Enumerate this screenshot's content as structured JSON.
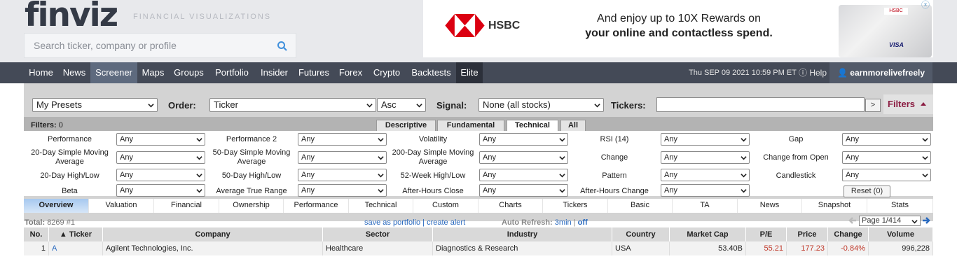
{
  "brand": {
    "logo": "finviz",
    "tagline": "FINANCIAL VISUALIZATIONS"
  },
  "search": {
    "placeholder": "Search ticker, company or profile",
    "icon": "search-icon"
  },
  "ad": {
    "brand": "HSBC",
    "line1": "And enjoy up to 10X Rewards on",
    "line2": "your online and contactless spend.",
    "card_brand": "HSBC",
    "card_network": "VISA",
    "close": "ⓧ"
  },
  "nav": {
    "items": [
      "Home",
      "News",
      "Screener",
      "Maps",
      "Groups",
      "Portfolio",
      "Insider",
      "Futures",
      "Forex",
      "Crypto",
      "Backtests",
      "Elite"
    ],
    "active": "Screener",
    "datetime": "Thu SEP 09 2021 10:59 PM ET",
    "help": "Help",
    "user": "earnmorelivefreely"
  },
  "controls": {
    "presets": "My Presets",
    "order_label": "Order:",
    "order_value": "Ticker",
    "direction": "Asc",
    "signal_label": "Signal:",
    "signal_value": "None (all stocks)",
    "tickers_label": "Tickers:",
    "tickers_value": "",
    "go": ">",
    "filters_toggle": "Filters"
  },
  "filters": {
    "title": "Filters:",
    "count": "0",
    "tabs": [
      "Descriptive",
      "Fundamental",
      "Technical",
      "All"
    ],
    "active_tab": "Technical",
    "rows": [
      [
        {
          "label": "Performance",
          "value": "Any"
        },
        {
          "label": "Performance 2",
          "value": "Any"
        },
        {
          "label": "Volatility",
          "value": "Any"
        },
        {
          "label": "RSI (14)",
          "value": "Any"
        },
        {
          "label": "Gap",
          "value": "Any"
        }
      ],
      [
        {
          "label": "20-Day Simple Moving Average",
          "value": "Any"
        },
        {
          "label": "50-Day Simple Moving Average",
          "value": "Any"
        },
        {
          "label": "200-Day Simple Moving Average",
          "value": "Any"
        },
        {
          "label": "Change",
          "value": "Any"
        },
        {
          "label": "Change from Open",
          "value": "Any"
        }
      ],
      [
        {
          "label": "20-Day High/Low",
          "value": "Any"
        },
        {
          "label": "50-Day High/Low",
          "value": "Any"
        },
        {
          "label": "52-Week High/Low",
          "value": "Any"
        },
        {
          "label": "Pattern",
          "value": "Any"
        },
        {
          "label": "Candlestick",
          "value": "Any"
        }
      ],
      [
        {
          "label": "Beta",
          "value": "Any"
        },
        {
          "label": "Average True Range",
          "value": "Any"
        },
        {
          "label": "After-Hours Close",
          "value": "Any"
        },
        {
          "label": "After-Hours Change",
          "value": "Any"
        }
      ]
    ],
    "reset": "Reset (0)"
  },
  "view_tabs": [
    "Overview",
    "Valuation",
    "Financial",
    "Ownership",
    "Performance",
    "Technical",
    "Custom",
    "Charts",
    "Tickers",
    "Basic",
    "TA",
    "News",
    "Snapshot",
    "Stats"
  ],
  "active_view": "Overview",
  "summary": {
    "total_label": "Total:",
    "total_value": "8269 #1",
    "save_portfolio": "save as portfolio",
    "separator": "|",
    "create_alert": "create alert",
    "auto_refresh_label": "Auto Refresh:",
    "auto_refresh_value": "3min",
    "auto_refresh_off": "off",
    "page": "Page 1/414"
  },
  "table": {
    "columns": [
      "No.",
      "▲ Ticker",
      "Company",
      "Sector",
      "Industry",
      "Country",
      "Market Cap",
      "P/E",
      "Price",
      "Change",
      "Volume"
    ],
    "rows": [
      [
        "1",
        "A",
        "Agilent Technologies, Inc.",
        "Healthcare",
        "Diagnostics & Research",
        "USA",
        "53.40B",
        "55.21",
        "177.23",
        "-0.84%",
        "996,228"
      ]
    ]
  },
  "colors": {
    "nav_bg": "#444a57",
    "active_tab": "#5e6a7e",
    "link": "#2a6abf",
    "negative": "#c0392b",
    "filters_toggle": "#8b1d42"
  }
}
